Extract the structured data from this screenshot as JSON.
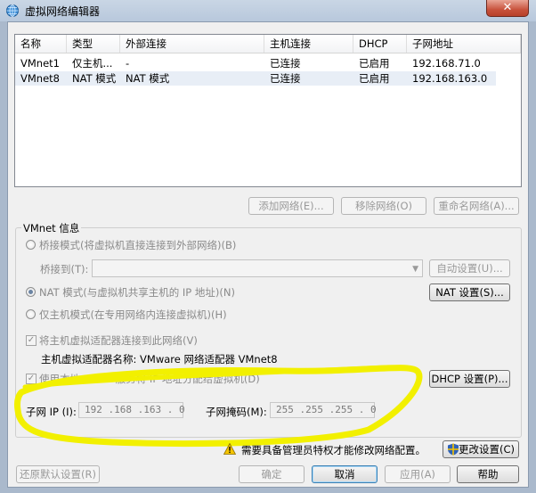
{
  "window": {
    "title": "虚拟网络编辑器",
    "close_glyph": "✕"
  },
  "table": {
    "headers": [
      "名称",
      "类型",
      "外部连接",
      "主机连接",
      "DHCP",
      "子网地址"
    ],
    "rows": [
      [
        "VMnet1",
        "仅主机...",
        "-",
        "已连接",
        "已启用",
        "192.168.71.0"
      ],
      [
        "VMnet8",
        "NAT 模式",
        "NAT 模式",
        "已连接",
        "已启用",
        "192.168.163.0"
      ]
    ]
  },
  "table_buttons": {
    "add": "添加网络(E)...",
    "remove": "移除网络(O)",
    "rename": "重命名网络(A)..."
  },
  "vmnet_info": {
    "title": "VMnet 信息",
    "bridge_mode": "桥接模式(将虚拟机直接连接到外部网络)(B)",
    "bridge_to_label": "桥接到(T):",
    "bridge_to_value": "",
    "auto_settings": "自动设置(U)...",
    "nat_mode": "NAT 模式(与虚拟机共享主机的 IP 地址)(N)",
    "nat_settings": "NAT 设置(S)...",
    "host_only": "仅主机模式(在专用网络内连接虚拟机)(H)",
    "connect_adapter": "将主机虚拟适配器连接到此网络(V)",
    "adapter_name": "主机虚拟适配器名称: VMware 网络适配器 VMnet8",
    "use_dhcp": "使用本地 DHCP 服务将 IP 地址分配给虚拟机(D)",
    "dhcp_settings": "DHCP 设置(P)...",
    "subnet_ip_label": "子网 IP (I):",
    "subnet_ip_value": "192 .168 .163 . 0",
    "subnet_mask_label": "子网掩码(M):",
    "subnet_mask_value": "255 .255 .255 . 0"
  },
  "admin_notice": {
    "text": "需要具备管理员特权才能修改网络配置。",
    "change_settings": "更改设置(C)"
  },
  "footer": {
    "restore_defaults": "还原默认设置(R)",
    "ok": "确定",
    "cancel": "取消",
    "apply": "应用(A)",
    "help": "帮助"
  },
  "colors": {
    "highlight_marker": "#f2f000",
    "title_bar": "#c9d6e5",
    "close_button": "#c8523c"
  }
}
